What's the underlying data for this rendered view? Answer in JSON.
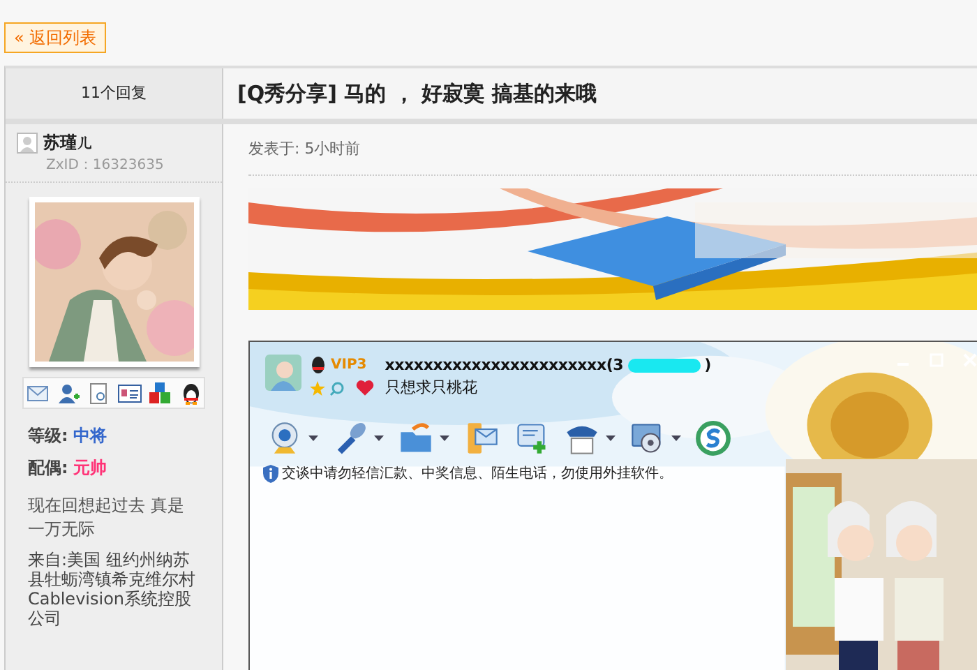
{
  "back_link": {
    "label": "« 返回列表"
  },
  "reply_count": "11个回复",
  "thread_title": "[Q秀分享] 马的 ， 好寂寞 搞基的来哦",
  "author": {
    "name": "苏瑾ㄦ",
    "zxid": "ZxID：16323635",
    "profile": [
      {
        "label": "等级:",
        "value": "中将",
        "color": "#3366cc"
      },
      {
        "label": "配偶:",
        "value": "元帅",
        "color": "#ff3377"
      }
    ],
    "signature": "现在回想起过去 真是一万无际",
    "location": "来自:美国 纽约州纳苏县牡蛎湾镇希克维尔村Cablevision系统控股公司"
  },
  "post": {
    "posted": "发表于: 5小时前",
    "qq_window": {
      "vip": "VIP3",
      "nickname": "xxxxxxxxxxxxxxxxxxxxxxx(3",
      "nickname_end": ")",
      "status": "只想求只桃花",
      "notice": "交谈中请勿轻信汇款、中奖信息、陌生电话，勿使用外挂软件。"
    }
  }
}
